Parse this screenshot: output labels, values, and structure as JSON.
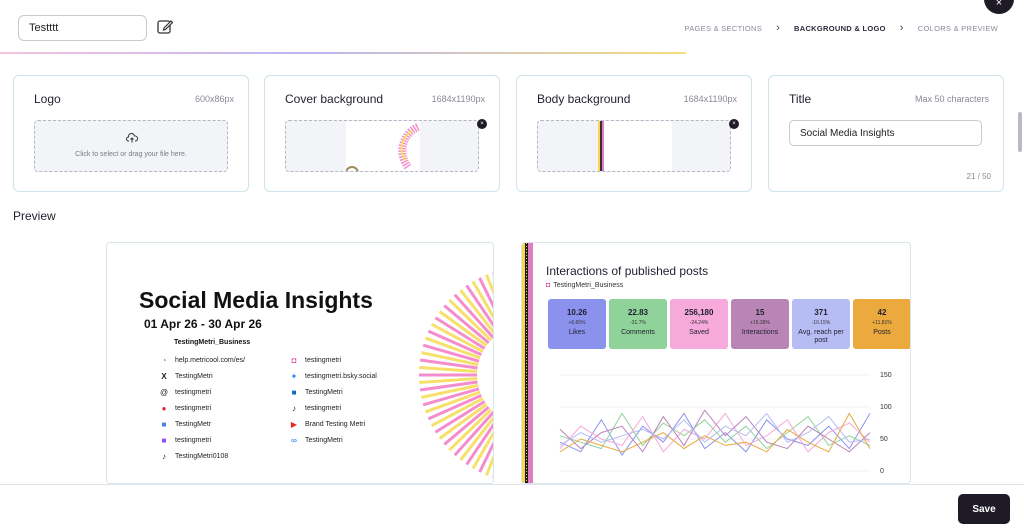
{
  "header": {
    "report_name": "Testttt",
    "steps": [
      "PAGES & SECTIONS",
      "BACKGROUND & LOGO",
      "COLORS & PREVIEW"
    ],
    "active_step": "BACKGROUND & LOGO",
    "close_glyph": "×"
  },
  "cards": {
    "logo": {
      "title": "Logo",
      "hint": "600x86px",
      "dropzone_text": "Click to select or drag your file here."
    },
    "cover": {
      "title": "Cover background",
      "hint": "1684x1190px"
    },
    "body": {
      "title": "Body background",
      "hint": "1684x1190px"
    },
    "title_card": {
      "title": "Title",
      "hint": "Max 50 characters",
      "value": "Social Media Insights",
      "counter": "21 / 50"
    }
  },
  "preview": {
    "label": "Preview",
    "cover": {
      "title": "Social Media Insights",
      "dates": "01 Apr 26 - 30 Apr 26",
      "account": "TestingMetri_Business",
      "links_left": [
        {
          "icon": "rss-icon",
          "text": "help.metricool.com/es/"
        },
        {
          "icon": "x-icon",
          "text": "TestingMetri"
        },
        {
          "icon": "threads-icon",
          "text": "testingmetri"
        },
        {
          "icon": "pinterest-icon",
          "text": "testingmetri"
        },
        {
          "icon": "gmb-icon",
          "text": "TestingMetr"
        },
        {
          "icon": "twitch-icon",
          "text": "testingmetri"
        },
        {
          "icon": "tiktok-icon",
          "text": "TestingMetri0108"
        }
      ],
      "links_right": [
        {
          "icon": "instagram-icon",
          "text": "testingmetri"
        },
        {
          "icon": "bluesky-icon",
          "text": "testingmetri.bsky.social"
        },
        {
          "icon": "linkedin-icon",
          "text": "TestingMetri"
        },
        {
          "icon": "tiktok-icon",
          "text": "testingmetri"
        },
        {
          "icon": "youtube-icon",
          "text": "Brand Testing Metri"
        },
        {
          "icon": "meta-icon",
          "text": "TestingMetri"
        }
      ]
    },
    "body": {
      "title": "Interactions of published posts",
      "account": "TestingMetri_Business",
      "kpis": [
        {
          "value": "10.26",
          "delta": "+6.65%",
          "label": "Likes",
          "color": "#8b92ee"
        },
        {
          "value": "22.83",
          "delta": "-31.7%",
          "label": "Comments",
          "color": "#8fd39a"
        },
        {
          "value": "256,180",
          "delta": "-24.24%",
          "label": "Saved",
          "color": "#f6a9db"
        },
        {
          "value": "15",
          "delta": "+15.38%",
          "label": "Interactions",
          "color": "#b985b6"
        },
        {
          "value": "371",
          "delta": "-10.15%",
          "label": "Avg. reach per post",
          "color": "#b6bdf4"
        },
        {
          "value": "42",
          "delta": "+11.81%",
          "label": "Posts",
          "color": "#eba93e"
        }
      ],
      "right_axis_ticks": [
        "150",
        "100",
        "50",
        "0"
      ]
    }
  },
  "footer": {
    "save_label": "Save"
  },
  "chart_data": {
    "type": "line",
    "ylim": [
      0,
      150
    ],
    "series": [
      {
        "color": "#8b92ee",
        "values": [
          45,
          30,
          80,
          25,
          70,
          45,
          90,
          35,
          60,
          30,
          80,
          50,
          40,
          70,
          35,
          90
        ]
      },
      {
        "color": "#8fd39a",
        "values": [
          55,
          45,
          35,
          90,
          40,
          75,
          55,
          80,
          45,
          70,
          35,
          60,
          85,
          40,
          55,
          40
        ]
      },
      {
        "color": "#f6a9db",
        "values": [
          35,
          70,
          50,
          40,
          85,
          30,
          65,
          50,
          90,
          40,
          55,
          80,
          30,
          60,
          75,
          45
        ]
      },
      {
        "color": "#b985b6",
        "values": [
          65,
          35,
          60,
          70,
          30,
          85,
          40,
          95,
          55,
          85,
          45,
          35,
          70,
          50,
          30,
          60
        ]
      },
      {
        "color": "#b6bdf4",
        "values": [
          40,
          60,
          45,
          55,
          65,
          50,
          80,
          45,
          70,
          55,
          90,
          45,
          60,
          85,
          45,
          50
        ]
      },
      {
        "color": "#eba93e",
        "values": [
          30,
          50,
          40,
          30,
          45,
          60,
          35,
          55,
          40,
          45,
          30,
          65,
          45,
          30,
          90,
          35
        ]
      }
    ]
  }
}
